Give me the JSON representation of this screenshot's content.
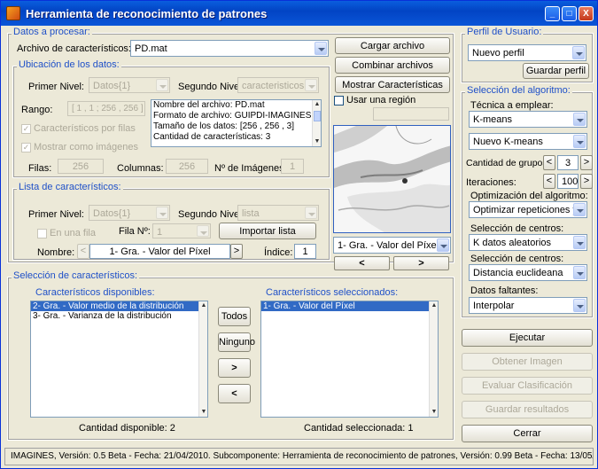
{
  "window": {
    "title": "Herramienta de reconocimiento de patrones",
    "min": "_",
    "max": "□",
    "close": "X"
  },
  "datos": {
    "legend": "Datos a procesar:",
    "archivo_label": "Archivo de característicos:",
    "archivo_value": "PD.mat",
    "ubicacion": {
      "legend": "Ubicación de los datos:",
      "primer_label": "Primer Nivel:",
      "primer_value": "Datos{1}",
      "segundo_label": "Segundo Nivel:",
      "segundo_value": "caracteristicos",
      "rango_label": "Rango:",
      "rango_value": "[ 1 , 1 ; 256 , 256 ]",
      "info": [
        "Nombre del archivo: PD.mat",
        "Formato de archivo: GUIPDI-IMAGINES",
        "Tamaño de los datos: [256 , 256 , 3]",
        "Cantidad de características: 3"
      ],
      "chk_filas": "Característicos por filas",
      "chk_imagenes": "Mostrar como imágenes",
      "filas_label": "Filas:",
      "filas_value": "256",
      "columnas_label": "Columnas:",
      "columnas_value": "256",
      "nimg_label": "Nº de Imágenes:",
      "nimg_value": "1"
    },
    "lista": {
      "legend": "Lista de característicos:",
      "primer_label": "Primer Nivel:",
      "primer_value": "Datos{1}",
      "segundo_label": "Segundo Nivel:",
      "segundo_value": "lista",
      "chk_fila": "En una fila",
      "filan_label": "Fila Nº:",
      "filan_value": "1",
      "importar": "Importar lista",
      "nombre_label": "Nombre:",
      "nombre_value": "1- Gra. - Valor del Píxel",
      "prev": "<",
      "next": ">",
      "indice_label": "Índice:",
      "indice_value": "1"
    }
  },
  "buttons": {
    "cargar": "Cargar archivo",
    "combinar": "Combinar archivos",
    "mostrar": "Mostrar Características",
    "region": "Usar una región"
  },
  "preview": {
    "select_value": "1- Gra. - Valor del Píxel",
    "prev": "<",
    "next": ">"
  },
  "seleccion": {
    "legend": "Selección de característicos:",
    "disp_label": "Característicos disponibles:",
    "disp_items": [
      "2- Gra. - Valor medio de la distribución",
      "3- Gra. - Varianza de la distribución"
    ],
    "sel_label": "Característicos seleccionados:",
    "sel_items": [
      "1- Gra. - Valor del Píxel"
    ],
    "todos": "Todos",
    "ninguno": "Ninguno",
    "add": ">",
    "remove": "<",
    "cant_disp": "Cantidad disponible: 2",
    "cant_sel": "Cantidad seleccionada: 1"
  },
  "perfil": {
    "legend": "Perfil de Usuario:",
    "value": "Nuevo perfil",
    "guardar": "Guardar perfil"
  },
  "algoritmo": {
    "legend": "Selección del algoritmo:",
    "tecnica_label": "Técnica a emplear:",
    "tecnica_value": "K-means",
    "sub_value": "Nuevo K-means",
    "grupos_label": "Cantidad de grupos:",
    "grupos_value": "3",
    "iter_label": "Iteraciones:",
    "iter_value": "100",
    "opt_label": "Optimización del algoritmo:",
    "opt_value": "Optimizar repeticiones y ...",
    "centros_label": "Selección de centros:",
    "centros_value": "K datos aleatorios",
    "dist_label": "Selección de centros:",
    "dist_value": "Distancia euclideana",
    "falt_label": "Datos faltantes:",
    "falt_value": "Interpolar",
    "dec": "<",
    "inc": ">"
  },
  "actions": {
    "ejecutar": "Ejecutar",
    "obtener": "Obtener Imagen",
    "evaluar": "Evaluar Clasificación",
    "guardar": "Guardar resultados",
    "cerrar": "Cerrar"
  },
  "status": "IMAGINES, Versión: 0.5 Beta - Fecha: 21/04/2010. Subcomponente: Herramienta de reconocimiento de patrones, Versión: 0.99 Beta - Fecha: 13/05/2010."
}
